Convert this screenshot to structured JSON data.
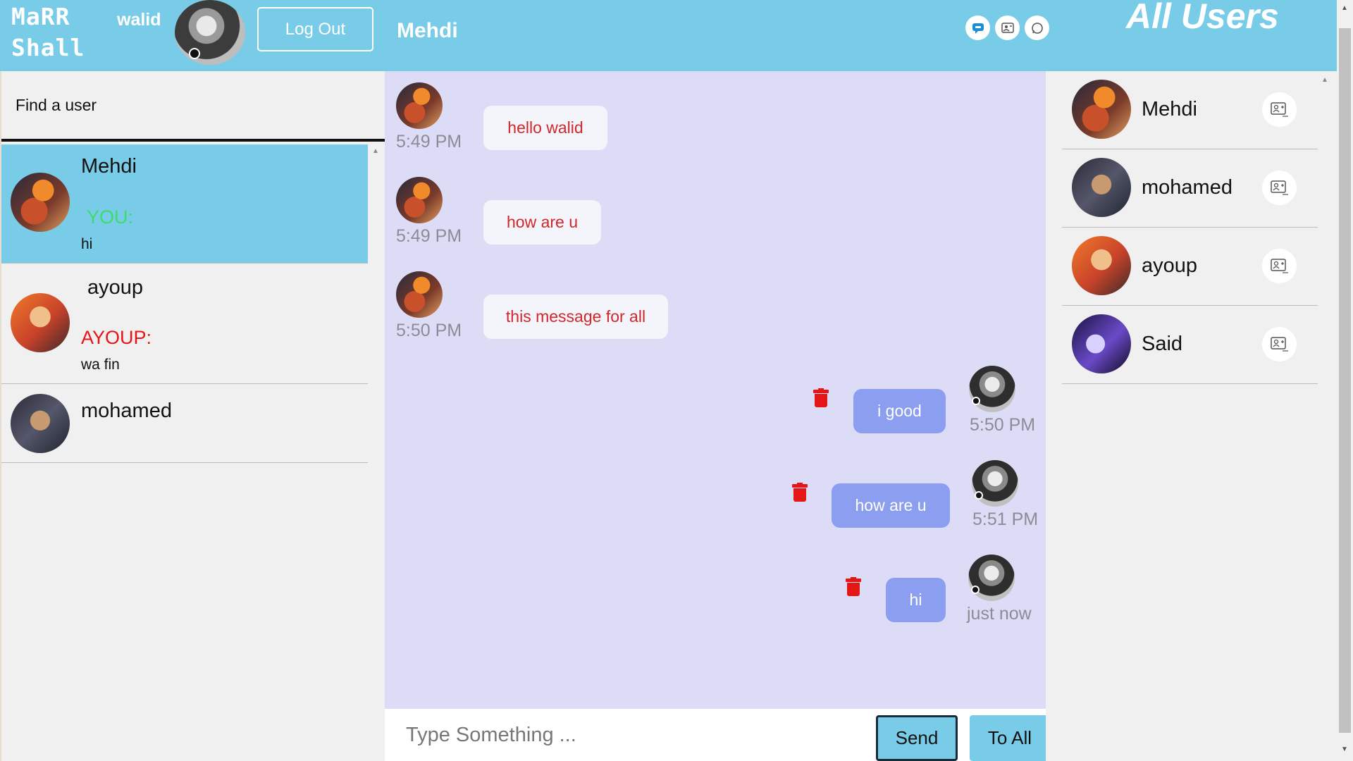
{
  "header": {
    "brand_line1": "MaRR",
    "brand_line2": "Shall",
    "username": "walid",
    "logout_label": "Log Out",
    "chat_title": "Mehdi",
    "all_users_title": "All Users",
    "icons": [
      "chat-bubble-icon",
      "contact-card-icon",
      "whatsapp-icon"
    ]
  },
  "left_panel": {
    "search_placeholder": "Find a user",
    "conversations": [
      {
        "name": "Mehdi",
        "sender": "YOU:",
        "last_message": "hi",
        "active": true
      },
      {
        "name": "ayoup",
        "sender": "AYOUP:",
        "last_message": "wa fin",
        "active": false
      },
      {
        "name": "mohamed",
        "sender": "",
        "last_message": "",
        "active": false
      }
    ]
  },
  "chat": {
    "messages": [
      {
        "direction": "in",
        "text": "hello walid",
        "time": "5:49 PM"
      },
      {
        "direction": "in",
        "text": "how are u",
        "time": "5:49 PM"
      },
      {
        "direction": "in",
        "text": "this message for all",
        "time": "5:50 PM"
      },
      {
        "direction": "out",
        "text": "i good",
        "time": "5:50 PM"
      },
      {
        "direction": "out",
        "text": "how are u",
        "time": "5:51 PM"
      },
      {
        "direction": "out",
        "text": "hi",
        "time": "just now"
      }
    ],
    "input_placeholder": "Type Something ...",
    "send_label": "Send",
    "to_all_label": "To All"
  },
  "right_panel": {
    "users": [
      {
        "name": "Mehdi"
      },
      {
        "name": "mohamed"
      },
      {
        "name": "ayoup"
      },
      {
        "name": "Said"
      }
    ]
  },
  "colors": {
    "header": "#78cce8",
    "chat_bg": "#dddcf7",
    "incoming_bubble": "#f4f4fb",
    "incoming_text": "#d0282a",
    "outgoing_bubble": "#8c9eef",
    "you_sender": "#3ddc6a",
    "other_sender": "#e51616",
    "trash": "#e51616"
  }
}
